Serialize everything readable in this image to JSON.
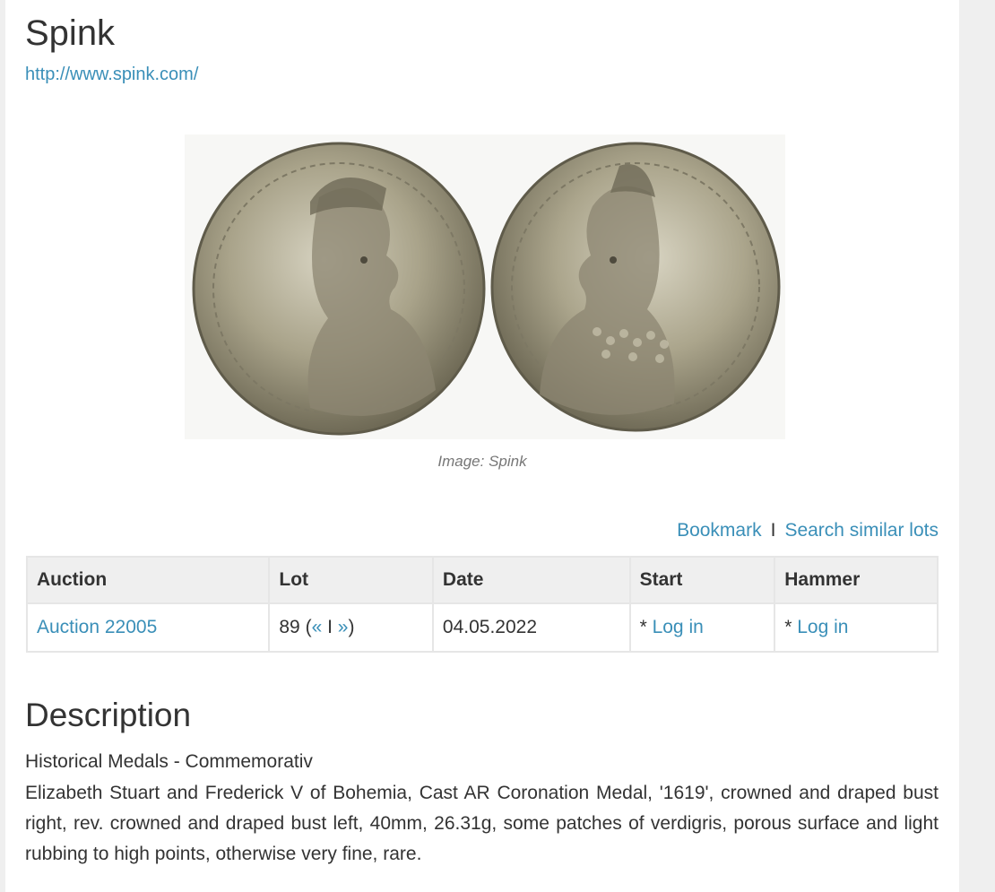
{
  "header": {
    "house_name": "Spink",
    "house_url": "http://www.spink.com/"
  },
  "image": {
    "credit": "Image: Spink",
    "icon": "coin-photo"
  },
  "actions": {
    "bookmark": "Bookmark",
    "separator": "I",
    "search_similar": "Search similar lots"
  },
  "table": {
    "headers": [
      "Auction",
      "Lot",
      "Date",
      "Start",
      "Hammer"
    ],
    "row": {
      "auction": "Auction 22005",
      "lot_number": "89",
      "lot_prev": "«",
      "lot_sep": "I",
      "lot_next": "»",
      "date": "04.05.2022",
      "start_prefix": "* ",
      "start_link": "Log in",
      "hammer_prefix": "* ",
      "hammer_link": "Log in"
    }
  },
  "description": {
    "title": "Description",
    "category": "Historical Medals - Commemorativ",
    "text": "Elizabeth Stuart and Frederick V of Bohemia, Cast AR Coronation Medal, '1619', crowned and draped bust right, rev. crowned and draped bust left, 40mm, 26.31g, some patches of verdigris, porous surface and light rubbing to high points, otherwise very fine, rare."
  },
  "colors": {
    "link": "#3a8fb8",
    "coin_silver": "#a8a28a",
    "header_bg": "#efefef"
  }
}
